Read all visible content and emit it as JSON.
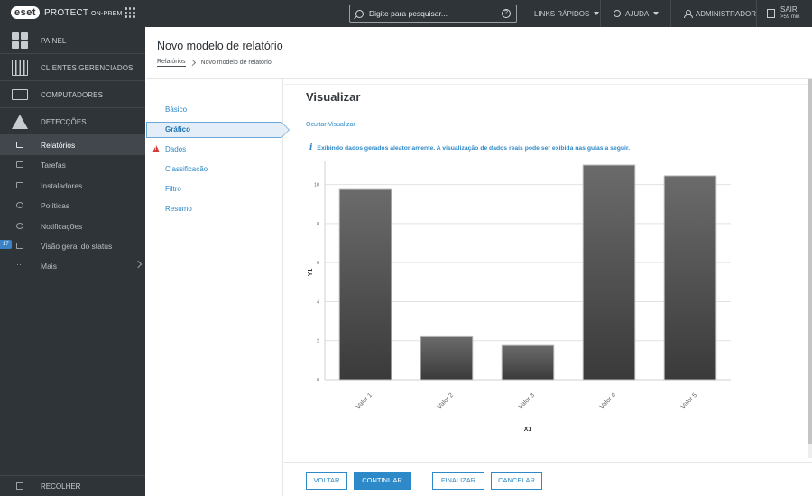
{
  "topbar": {
    "logo_badge": "eset",
    "product": "PROTECT",
    "product_suffix": "ON-PREM",
    "search_placeholder": "Digite para pesquisar...",
    "help_glyph": "?",
    "quick_links": "LINKS RÁPIDOS",
    "help": "AJUDA",
    "user": "ADMINISTRADOR",
    "logout": "SAIR",
    "logout_sub": ">59 min"
  },
  "sidebar": {
    "main": [
      {
        "label": "PAINEL",
        "icon": "dashboard-icon"
      },
      {
        "label": "CLIENTES GERENCIADOS",
        "icon": "building-icon"
      },
      {
        "label": "COMPUTADORES",
        "icon": "monitor-icon"
      },
      {
        "label": "DETECÇÕES",
        "icon": "warning-icon"
      }
    ],
    "items": [
      {
        "label": "Relatórios",
        "icon": "reports-icon"
      },
      {
        "label": "Tarefas",
        "icon": "tasks-icon"
      },
      {
        "label": "Instaladores",
        "icon": "installer-icon"
      },
      {
        "label": "Políticas",
        "icon": "policy-icon"
      },
      {
        "label": "Notificações",
        "icon": "notification-icon"
      },
      {
        "label": "Visão geral do status",
        "icon": "status-icon"
      },
      {
        "label": "Mais",
        "icon": "more-icon"
      }
    ],
    "status_badge": "17",
    "more_glyph": "···",
    "collapse": "RECOLHER"
  },
  "page": {
    "title": "Novo modelo de relatório",
    "breadcrumb_root": "Relatórios",
    "breadcrumb_current": "Novo modelo de relatório"
  },
  "wizard": {
    "steps": [
      "Básico",
      "Gráfico",
      "Dados",
      "Classificação",
      "Filtro",
      "Resumo"
    ]
  },
  "content": {
    "section_title": "Visualizar",
    "hide_link": "Ocultar Visualizar",
    "info_glyph": "i",
    "info_text": "Exibindo dados gerados aleatoriamente. A visualização de dados reais pode ser exibida nas guias a seguir."
  },
  "chart_data": {
    "type": "bar",
    "categories": [
      "Valor 1",
      "Valor 2",
      "Valor 3",
      "Valor 4",
      "Valor 5"
    ],
    "values": [
      9.75,
      2.2,
      1.75,
      11.0,
      10.45
    ],
    "xlabel": "X1",
    "ylabel": "Y1",
    "ylim": [
      0,
      11
    ],
    "yticks": [
      0,
      2,
      4,
      6,
      8,
      10
    ],
    "grid": true,
    "bar_color": "#3a3a3a"
  },
  "footer": {
    "back": "VOLTAR",
    "continue": "CONTINUAR",
    "finish": "FINALIZAR",
    "cancel": "CANCELAR"
  },
  "colors": {
    "accent": "#2d89c8",
    "sidebar": "#2f3438",
    "error": "#d33a3a"
  }
}
